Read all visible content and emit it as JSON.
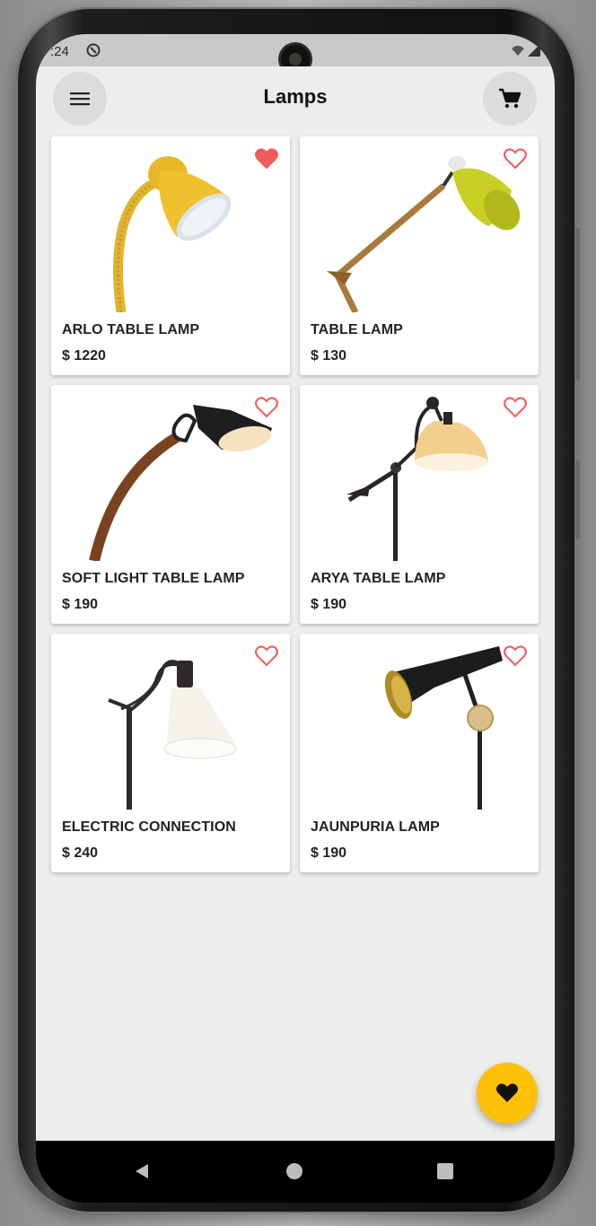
{
  "status_bar": {
    "time": ":24"
  },
  "app": {
    "title": "Lamps"
  },
  "products": [
    {
      "name": "ARLO TABLE LAMP",
      "price": "$ 1220",
      "favorite": true
    },
    {
      "name": "TABLE LAMP",
      "price": "$ 130",
      "favorite": false
    },
    {
      "name": "SOFT LIGHT TABLE LAMP",
      "price": "$ 190",
      "favorite": false
    },
    {
      "name": "ARYA TABLE LAMP",
      "price": "$ 190",
      "favorite": false
    },
    {
      "name": "ELECTRIC CONNECTION",
      "price": "$ 240",
      "favorite": false
    },
    {
      "name": "JAUNPURIA LAMP",
      "price": "$ 190",
      "favorite": false
    }
  ],
  "icons": {
    "menu": "menu-icon",
    "cart": "cart-icon",
    "favorite": "heart-icon",
    "fab": "heart-icon",
    "nav": [
      "back-icon",
      "home-icon",
      "recents-icon"
    ]
  },
  "colors": {
    "heart": "#f25b5b",
    "fab": "#ffc107",
    "background": "#ededed"
  }
}
